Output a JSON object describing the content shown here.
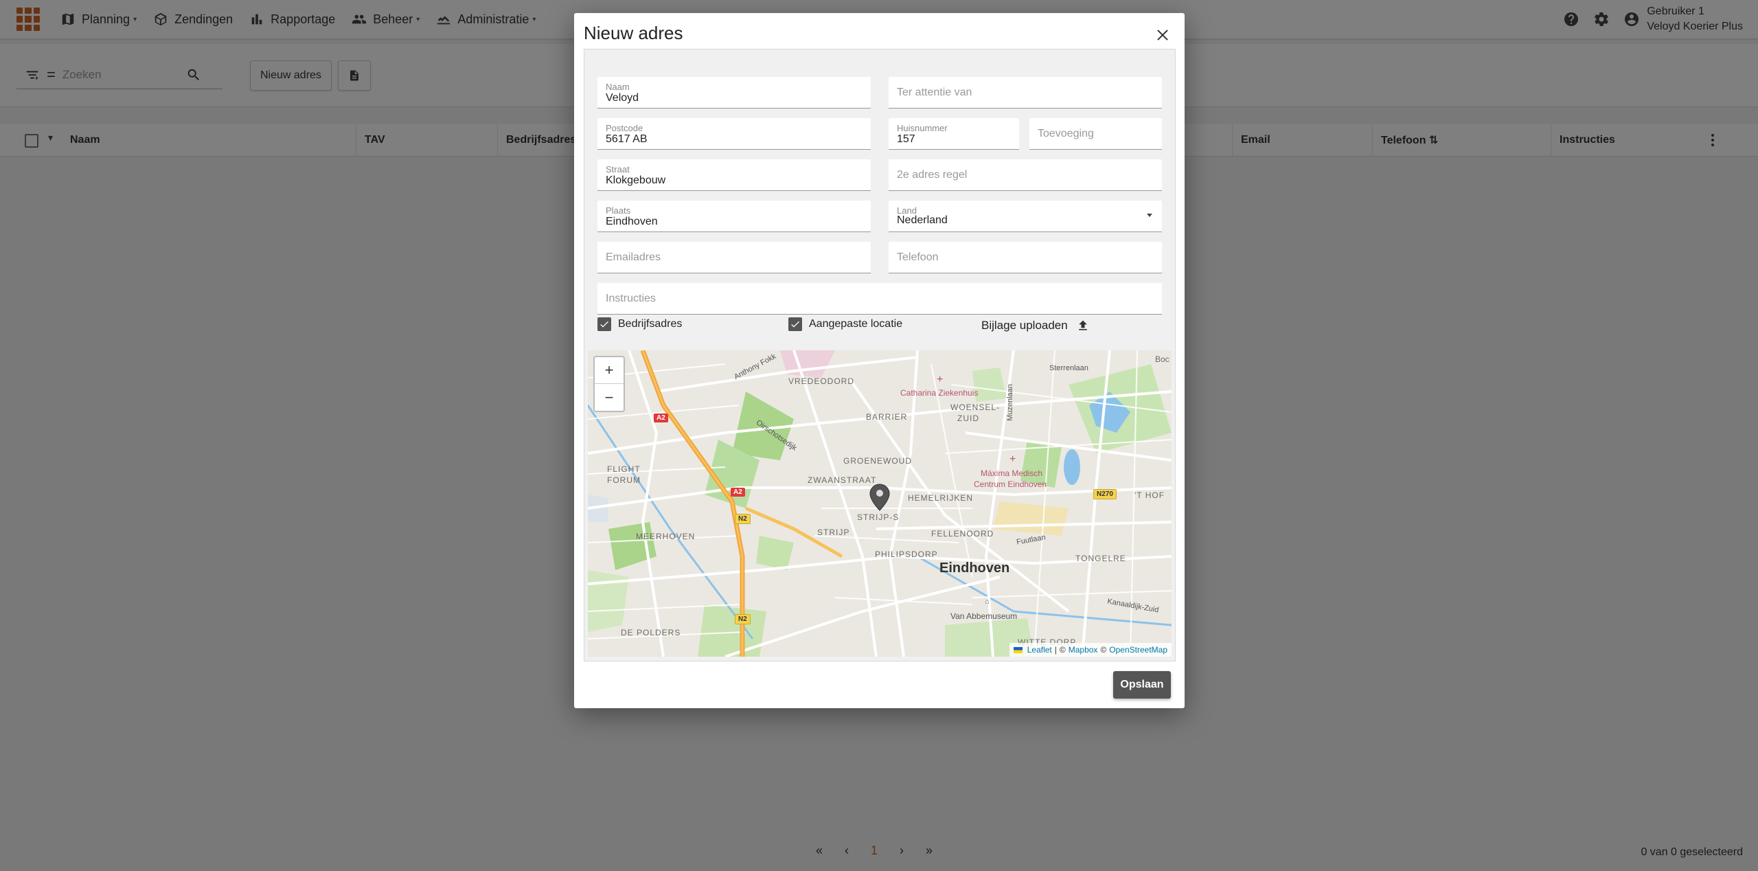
{
  "topbar": {
    "nav": [
      {
        "label": "Planning",
        "icon": "map-icon",
        "dropdown": true
      },
      {
        "label": "Zendingen",
        "icon": "package-icon",
        "dropdown": false
      },
      {
        "label": "Rapportage",
        "icon": "bar-chart-icon",
        "dropdown": false
      },
      {
        "label": "Beheer",
        "icon": "people-icon",
        "dropdown": true
      },
      {
        "label": "Administratie",
        "icon": "handshake-icon",
        "dropdown": true
      }
    ],
    "user_name": "Gebruiker 1",
    "user_company": "Veloyd Koerier Plus",
    "brand_color": "#d0662a"
  },
  "toolbar": {
    "search_placeholder": "Zoeken",
    "eq_symbol": "=",
    "new_address_label": "Nieuw adres"
  },
  "table": {
    "columns": [
      "Naam",
      "TAV",
      "Bedrijfsadres",
      "Email",
      "Telefoon ⇅",
      "Instructies"
    ]
  },
  "pager": {
    "first": "«",
    "prev": "‹",
    "current": "1",
    "next": "›",
    "last": "»",
    "selected_text": "0 van 0 geselecteerd"
  },
  "dialog": {
    "title": "Nieuw adres",
    "fields": {
      "naam": {
        "label": "Naam",
        "value": "Veloyd"
      },
      "tav": {
        "placeholder": "Ter attentie van"
      },
      "postcode": {
        "label": "Postcode",
        "value": "5617 AB"
      },
      "huisnummer": {
        "label": "Huisnummer",
        "value": "157"
      },
      "toevoeging": {
        "placeholder": "Toevoeging"
      },
      "straat": {
        "label": "Straat",
        "value": "Klokgebouw"
      },
      "adresregel2": {
        "placeholder": "2e adres regel"
      },
      "plaats": {
        "label": "Plaats",
        "value": "Eindhoven"
      },
      "land": {
        "label": "Land",
        "value": "Nederland"
      },
      "email": {
        "placeholder": "Emailadres"
      },
      "telefoon": {
        "placeholder": "Telefoon"
      },
      "instructies": {
        "placeholder": "Instructies"
      }
    },
    "checkboxes": {
      "bedrijfsadres": {
        "label": "Bedrijfsadres",
        "checked": true
      },
      "aangepaste_locatie": {
        "label": "Aangepaste locatie",
        "checked": true
      }
    },
    "upload_label": "Bijlage uploaden",
    "save_label": "Opslaan",
    "map": {
      "zoom_in": "+",
      "zoom_out": "−",
      "labels": {
        "vredeoord": "VREDEODORD",
        "catharina": "Catharina Ziekenhuis",
        "woensel": "WOENSEL-",
        "zuid": "ZUID",
        "barrier": "BARRIER",
        "anthony": "Anthony Fokk",
        "sterrenlaan": "Sterrenlaan",
        "boc": "Boc",
        "muzenlaan": "Muzenlaan",
        "dirschot": "Oirschotsedijk",
        "flight1": "FLIGHT",
        "flight2": "FORUM",
        "groenewoud": "GROENEWOUD",
        "zwaanstraat": "ZWAANSTRAAT",
        "maxima1": "Máxima Medisch",
        "maxima2": "Centrum Eindhoven",
        "hemelrijken": "HEMELRIJKEN",
        "strijp": "STRIJP-S",
        "fellenoord": "FELLENOORD",
        "thof": "'T HOF",
        "meerhoven": "MEERHOVEN",
        "strijp2": "STRIJP",
        "philipsdorp": "PHILIPSDORP",
        "fuutlaan": "Fuutlaan",
        "tongelre": "TONGELRE",
        "eindhoven": "Eindhoven",
        "kanaaldijk": "Kanaaldijk-Zuid",
        "vanabbe": "Van Abbemuseum",
        "depolders": "DE POLDERS",
        "witte": "WITTE DORP"
      },
      "badges": {
        "a2a": "A2",
        "a2b": "A2",
        "n2a": "N2",
        "n2b": "N2",
        "n270": "N270"
      },
      "attribution": {
        "leaflet": "Leaflet",
        "sep1": "|",
        "c1": "©",
        "mapbox": "Mapbox",
        "c2": "©",
        "osm": "OpenStreetMap"
      }
    }
  }
}
